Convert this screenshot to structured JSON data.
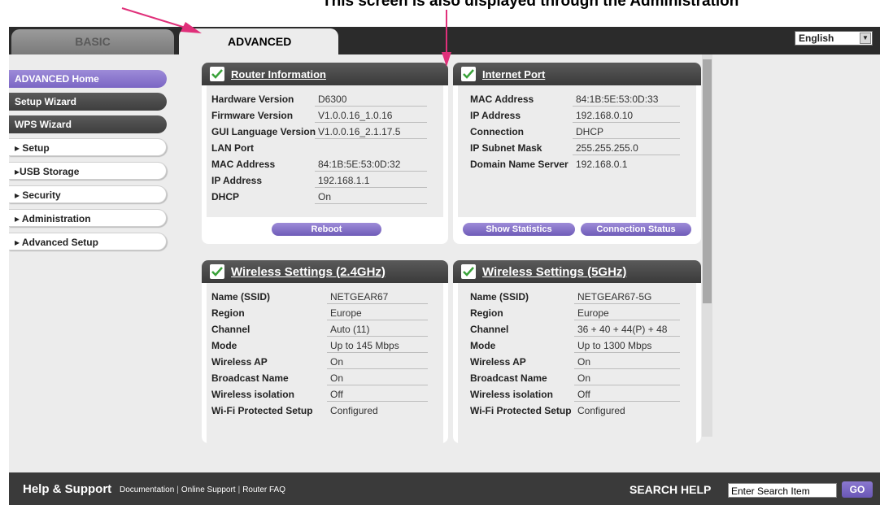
{
  "annotation": {
    "text": "This screen is also displayed through the Administration"
  },
  "tabs": {
    "basic": "BASIC",
    "advanced": "ADVANCED"
  },
  "language": {
    "selected": "English"
  },
  "sidebar": {
    "items": [
      {
        "label": "ADVANCED Home"
      },
      {
        "label": "Setup Wizard"
      },
      {
        "label": "WPS Wizard"
      },
      {
        "label": "▸ Setup"
      },
      {
        "label": "▸USB Storage"
      },
      {
        "label": "▸ Security"
      },
      {
        "label": "▸ Administration"
      },
      {
        "label": "▸ Advanced Setup"
      }
    ]
  },
  "router_info": {
    "title": "Router Information",
    "rows": [
      {
        "k": "Hardware Version",
        "v": "D6300"
      },
      {
        "k": "Firmware Version",
        "v": "V1.0.0.16_1.0.16"
      },
      {
        "k": "GUI Language Version",
        "v": "V1.0.0.16_2.1.17.5"
      },
      {
        "k": "LAN Port",
        "v": ""
      },
      {
        "k": "MAC Address",
        "v": "84:1B:5E:53:0D:32"
      },
      {
        "k": "IP Address",
        "v": "192.168.1.1"
      },
      {
        "k": "DHCP",
        "v": "On"
      }
    ],
    "reboot": "Reboot"
  },
  "internet_port": {
    "title": "Internet Port",
    "rows": [
      {
        "k": "MAC Address",
        "v": "84:1B:5E:53:0D:33"
      },
      {
        "k": "IP Address",
        "v": "192.168.0.10"
      },
      {
        "k": "Connection",
        "v": "DHCP"
      },
      {
        "k": "IP Subnet Mask",
        "v": "255.255.255.0"
      },
      {
        "k": "Domain Name Server",
        "v": "192.168.0.1"
      }
    ],
    "show_statistics": "Show Statistics",
    "connection_status": "Connection Status"
  },
  "wireless_24": {
    "title": "Wireless Settings (2.4GHz)",
    "rows": [
      {
        "k": "Name (SSID)",
        "v": "NETGEAR67"
      },
      {
        "k": "Region",
        "v": "Europe"
      },
      {
        "k": "Channel",
        "v": "Auto (11)"
      },
      {
        "k": "Mode",
        "v": "Up to 145 Mbps"
      },
      {
        "k": "Wireless AP",
        "v": "On"
      },
      {
        "k": "Broadcast Name",
        "v": "On"
      },
      {
        "k": "Wireless isolation",
        "v": "Off"
      },
      {
        "k": "Wi-Fi Protected Setup",
        "v": "Configured"
      }
    ]
  },
  "wireless_5": {
    "title": "Wireless Settings (5GHz)",
    "rows": [
      {
        "k": "Name (SSID)",
        "v": "NETGEAR67-5G"
      },
      {
        "k": "Region",
        "v": "Europe"
      },
      {
        "k": "Channel",
        "v": "36 + 40 + 44(P) + 48"
      },
      {
        "k": "Mode",
        "v": "Up to 1300 Mbps"
      },
      {
        "k": "Wireless AP",
        "v": "On"
      },
      {
        "k": "Broadcast Name",
        "v": "On"
      },
      {
        "k": "Wireless isolation",
        "v": "Off"
      },
      {
        "k": "Wi-Fi Protected Setup",
        "v": "Configured"
      }
    ]
  },
  "footer": {
    "help": "Help & Support",
    "links": [
      "Documentation",
      "Online Support",
      "Router FAQ"
    ],
    "search_label": "SEARCH HELP",
    "search_placeholder": "Enter Search Item",
    "go": "GO"
  },
  "colors": {
    "accent_purple": "#7b66c4",
    "header_dark": "#3a3a3a",
    "lan_port_blue": "#4b8fc9",
    "annotation_arrow": "#e0307a"
  }
}
